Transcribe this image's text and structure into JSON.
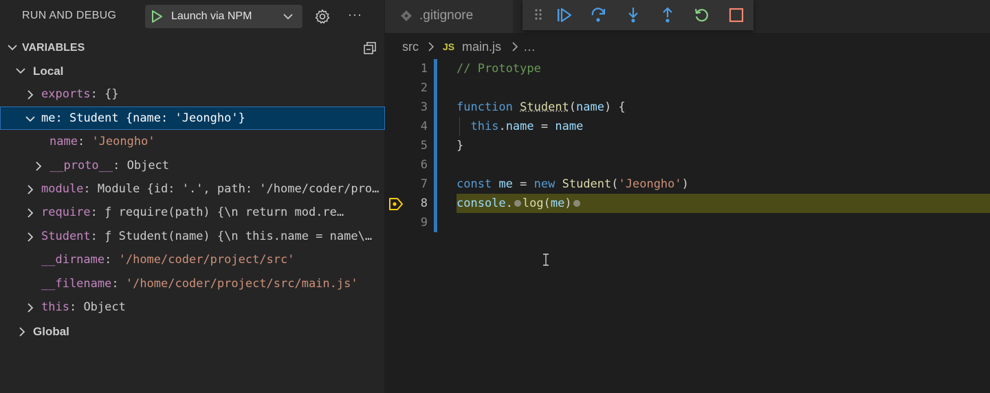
{
  "sidebar": {
    "title": "RUN AND DEBUG",
    "launch_config": "Launch via NPM",
    "more_label": "···",
    "variables_title": "VARIABLES",
    "rows": [
      {
        "name": "Local"
      },
      {
        "key": "exports",
        "value": "{}"
      },
      {
        "key": "me",
        "value": "Student {name: 'Jeongho'}"
      },
      {
        "key": "name",
        "value": "'Jeongho'"
      },
      {
        "key": "__proto__",
        "value": "Object"
      },
      {
        "key": "module",
        "value": "Module {id: '.', path: '/home/coder/pro…"
      },
      {
        "key": "require",
        "value": "ƒ require(path) {\\n      return mod.re…"
      },
      {
        "key": "Student",
        "value": "ƒ Student(name) {\\n  this.name = name\\…"
      },
      {
        "key": "__dirname",
        "value": "'/home/coder/project/src'"
      },
      {
        "key": "__filename",
        "value": "'/home/coder/project/src/main.js'"
      },
      {
        "key": "this",
        "value": "Object"
      },
      {
        "name": "Global"
      }
    ]
  },
  "editor": {
    "tab_label": ".gitignore",
    "breadcrumb": {
      "folder": "src",
      "file_badge": "JS",
      "file": "main.js",
      "tail": "…"
    },
    "lines": [
      {
        "n": "1",
        "text": "// Prototype"
      },
      {
        "n": "2",
        "text": ""
      },
      {
        "n": "3",
        "text": "function Student(name) {"
      },
      {
        "n": "4",
        "text": "  this.name = name"
      },
      {
        "n": "5",
        "text": "}"
      },
      {
        "n": "6",
        "text": ""
      },
      {
        "n": "7",
        "text": "const me = new Student('Jeongho')"
      },
      {
        "n": "8",
        "text": "console.log(me)"
      },
      {
        "n": "9",
        "text": ""
      }
    ],
    "current_line": 8
  },
  "colors": {
    "accent": "#2f78b8",
    "selection": "#04395e",
    "current_line": "#4b4b18",
    "debug_blue": "#4a9de6",
    "restart_green": "#89d185",
    "stop_red": "#f48771"
  }
}
